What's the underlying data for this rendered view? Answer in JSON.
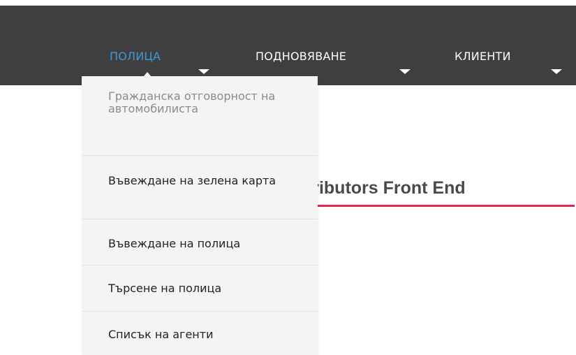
{
  "nav": {
    "items": [
      {
        "label": "ПОЛИЦА",
        "active": true
      },
      {
        "label": "ПОДНОВЯВАНЕ",
        "active": false
      },
      {
        "label": "КЛИЕНТИ",
        "active": false
      }
    ]
  },
  "dropdown": {
    "items": [
      {
        "label": "Гражданска отговорност на автомобилиста",
        "muted": true
      },
      {
        "label": "Въвеждане на зелена карта",
        "muted": false
      },
      {
        "label": "Въвеждане на полица",
        "muted": false
      },
      {
        "label": "Търсене на полица",
        "muted": false
      },
      {
        "label": "Списък на агенти",
        "muted": false
      }
    ]
  },
  "main": {
    "title": "Distributors Front End"
  },
  "colors": {
    "navbar_bg": "#3f3f41",
    "active_nav": "#3d9ad6",
    "accent_underline": "#e3274c",
    "dropdown_bg": "#f4f4f4"
  }
}
